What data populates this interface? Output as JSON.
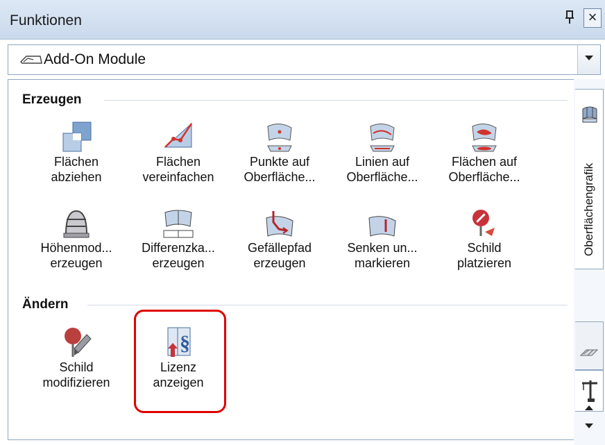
{
  "window": {
    "title": "Funktionen",
    "pin_label": "ᵖ",
    "close_label": "×"
  },
  "combo": {
    "selected": "Add-On Module"
  },
  "groups": [
    {
      "header": "Erzeugen"
    },
    {
      "header": "Ändern"
    }
  ],
  "items": [
    {
      "line1": "Flächen",
      "line2": "abziehen",
      "icon": "subtract-area-icon"
    },
    {
      "line1": "Flächen",
      "line2": "vereinfachen",
      "icon": "simplify-area-icon"
    },
    {
      "line1": "Punkte auf",
      "line2": "Oberfläche...",
      "icon": "surface-points-icon"
    },
    {
      "line1": "Linien auf",
      "line2": "Oberfläche...",
      "icon": "surface-lines-icon"
    },
    {
      "line1": "Flächen auf",
      "line2": "Oberfläche...",
      "icon": "surface-areas-icon"
    },
    {
      "line1": "Höhenmod...",
      "line2": "erzeugen",
      "icon": "height-model-icon"
    },
    {
      "line1": "Differenzka...",
      "line2": "erzeugen",
      "icon": "difference-map-icon"
    },
    {
      "line1": "Gefällepfad",
      "line2": "erzeugen",
      "icon": "slope-path-icon"
    },
    {
      "line1": "Senken un...",
      "line2": "markieren",
      "icon": "depressions-icon"
    },
    {
      "line1": "Schild",
      "line2": "platzieren",
      "icon": "place-sign-icon"
    },
    {
      "line1": "Schild",
      "line2": "modifizieren",
      "icon": "modify-sign-icon"
    },
    {
      "line1": "Lizenz",
      "line2": "anzeigen",
      "icon": "license-icon"
    }
  ],
  "sidebar": {
    "tab_label": "Oberflächengrafik"
  }
}
